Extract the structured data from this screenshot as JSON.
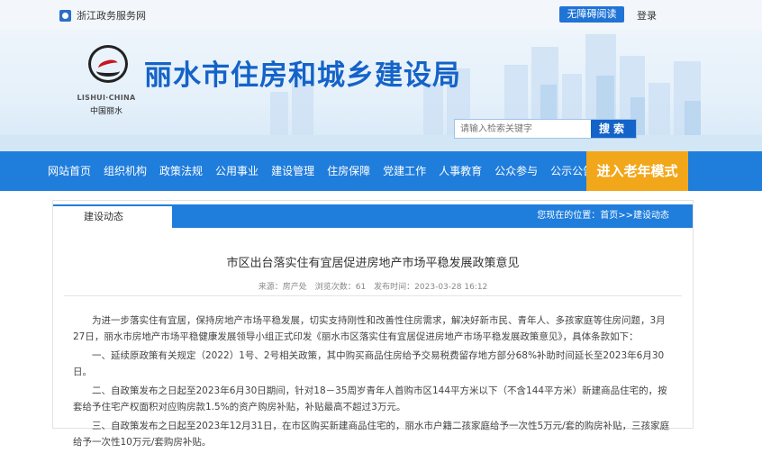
{
  "topbar": {
    "gov_site": "浙江政务服务网",
    "accessible": "无障碍阅读",
    "login": "登录"
  },
  "header": {
    "logo_en": "LISHUI·CHINA",
    "logo_cn": "中国丽水",
    "title": "丽水市住房和城乡建设局",
    "search_placeholder": "请输入检索关键字",
    "search_button": "搜索"
  },
  "nav": {
    "items": [
      "网站首页",
      "组织机构",
      "政策法规",
      "公用事业",
      "建设管理",
      "住房保障",
      "党建工作",
      "人事教育",
      "公众参与",
      "公示公告"
    ],
    "elder_mode": "进入老年模式"
  },
  "breadcrumb": {
    "section": "建设动态",
    "path": "您现在的位置：首页>>建设动态"
  },
  "article": {
    "title": "市区出台落实住有宜居促进房地产市场平稳发展政策意见",
    "meta": "来源：房产处　浏览次数：61　发布时间：2023-03-28 16:12",
    "paragraphs": [
      "为进一步落实住有宜居，保持房地产市场平稳发展，切实支持刚性和改善性住房需求，解决好新市民、青年人、多孩家庭等住房问题，3月27日，丽水市房地产市场平稳健康发展领导小组正式印发《丽水市区落实住有宜居促进房地产市场平稳发展政策意见》，具体条款如下：",
      "一、延续原政策有关规定（2022）1号、2号相关政策，其中购买商品住房给予交易税费留存地方部分68%补助时间延长至2023年6月30日。",
      "二、自政策发布之日起至2023年6月30日期间，针对18－35周岁青年人首购市区144平方米以下（不含144平方米）新建商品住宅的，按套给予住宅产权面积对应购房款1.5%的资产购房补贴，补贴最高不超过3万元。",
      "三、自政策发布之日起至2023年12月31日，在市区购买新建商品住宅的，丽水市户籍二孩家庭给予一次性5万元/套的购房补贴，三孩家庭给予一次性10万元/套购房补贴。"
    ]
  }
}
